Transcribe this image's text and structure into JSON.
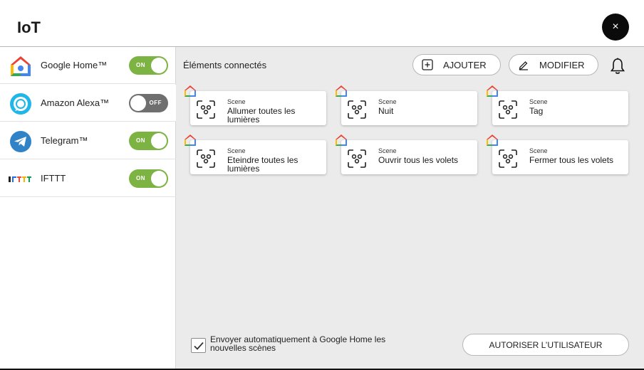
{
  "app": {
    "title": "IoT",
    "close_symbol": "×"
  },
  "sidebar": {
    "items": [
      {
        "label": "Google Home™",
        "icon": "google-home-icon",
        "toggle": {
          "state": "on",
          "text": "ON"
        }
      },
      {
        "label": "Amazon Alexa™",
        "icon": "alexa-icon",
        "toggle": {
          "state": "off",
          "text": "OFF"
        }
      },
      {
        "label": "Telegram™",
        "icon": "telegram-icon",
        "toggle": {
          "state": "on",
          "text": "ON"
        }
      },
      {
        "label": "IFTTT",
        "icon": "ifttt-logo",
        "toggle": {
          "state": "on",
          "text": "ON"
        }
      }
    ]
  },
  "main": {
    "section_title": "Éléments connectés",
    "add_button": {
      "label": "AJOUTER",
      "icon": "plus-square-icon"
    },
    "edit_button": {
      "label": "MODIFIER",
      "icon": "pencil-icon"
    },
    "notifications_icon": "bell-icon",
    "cards": [
      {
        "type": "Scene",
        "name": "Allumer toutes les lumières"
      },
      {
        "type": "Scene",
        "name": "Nuit"
      },
      {
        "type": "Scene",
        "name": "Tag"
      },
      {
        "type": "Scene",
        "name": "Eteindre toutes les lumières"
      },
      {
        "type": "Scene",
        "name": "Ouvrir tous les volets"
      },
      {
        "type": "Scene",
        "name": "Fermer tous les volets"
      }
    ],
    "auto_send": {
      "checked": true,
      "label": "Envoyer automatiquement à Google Home les nouvelles scènes"
    },
    "authorize_button": {
      "label": "AUTORISER L’UTILISATEUR"
    }
  },
  "colors": {
    "toggle_on": "#7cb342",
    "toggle_off": "#6f6f6f",
    "main_bg": "#ebebeb",
    "close_button": "#0b0b0b"
  }
}
